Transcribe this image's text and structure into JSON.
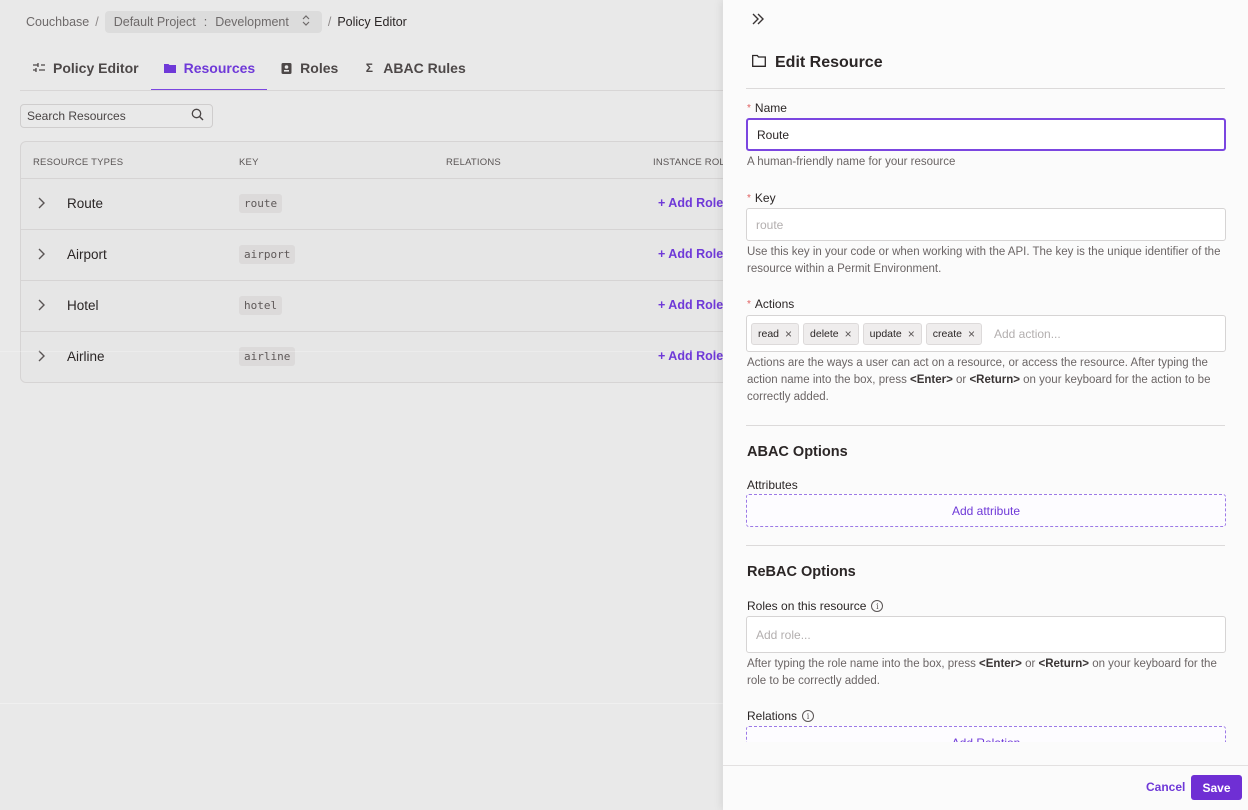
{
  "breadcrumb": {
    "org": "Couchbase",
    "separator": "/",
    "project": "Default Project",
    "environment": "Development",
    "current": "Policy Editor"
  },
  "tabs": [
    {
      "label": "Policy Editor",
      "icon": "sliders-icon",
      "active": false
    },
    {
      "label": "Resources",
      "icon": "folder-icon",
      "active": true
    },
    {
      "label": "Roles",
      "icon": "badge-icon",
      "active": false
    },
    {
      "label": "ABAC Rules",
      "icon": "sigma-icon",
      "active": false
    }
  ],
  "search": {
    "placeholder": "Search Resources"
  },
  "table": {
    "headers": [
      "RESOURCE TYPES",
      "KEY",
      "RELATIONS",
      "INSTANCE ROLE"
    ],
    "rows": [
      {
        "name": "Route",
        "key": "route",
        "action": "+ Add Roles"
      },
      {
        "name": "Airport",
        "key": "airport",
        "action": "+ Add Roles"
      },
      {
        "name": "Hotel",
        "key": "hotel",
        "action": "+ Add Roles"
      },
      {
        "name": "Airline",
        "key": "airline",
        "action": "+ Add Roles"
      }
    ]
  },
  "panel": {
    "title": "Edit Resource",
    "name": {
      "label": "Name",
      "value": "Route",
      "help": "A human-friendly name for your resource"
    },
    "key": {
      "label": "Key",
      "placeholder": "route",
      "help": "Use this key in your code or when working with the API. The key is the unique identifier of the resource within a Permit Environment."
    },
    "actions": {
      "label": "Actions",
      "chips": [
        "read",
        "delete",
        "update",
        "create"
      ],
      "placeholder": "Add action...",
      "help_pre": "Actions are the ways a user can act on a resource, or access the resource. After typing the action name into the box, press ",
      "help_k1": "<Enter>",
      "help_mid": " or ",
      "help_k2": "<Return>",
      "help_post": " on your keyboard for the action to be correctly added."
    },
    "abac": {
      "title": "ABAC Options",
      "attributes_label": "Attributes",
      "add_attribute": "Add attribute"
    },
    "rebac": {
      "title": "ReBAC Options",
      "roles_label": "Roles on this resource",
      "roles_placeholder": "Add role...",
      "help_pre": "After typing the role name into the box, press ",
      "help_k1": "<Enter>",
      "help_mid": " or ",
      "help_k2": "<Return>",
      "help_post": " on your keyboard for the role to be correctly added.",
      "relations_label": "Relations",
      "add_relation": "Add Relation"
    },
    "footer": {
      "cancel": "Cancel",
      "save": "Save"
    }
  },
  "colors": {
    "accent": "#6f39d8",
    "save_button": "#6f2fd4",
    "required": "#e06060"
  }
}
